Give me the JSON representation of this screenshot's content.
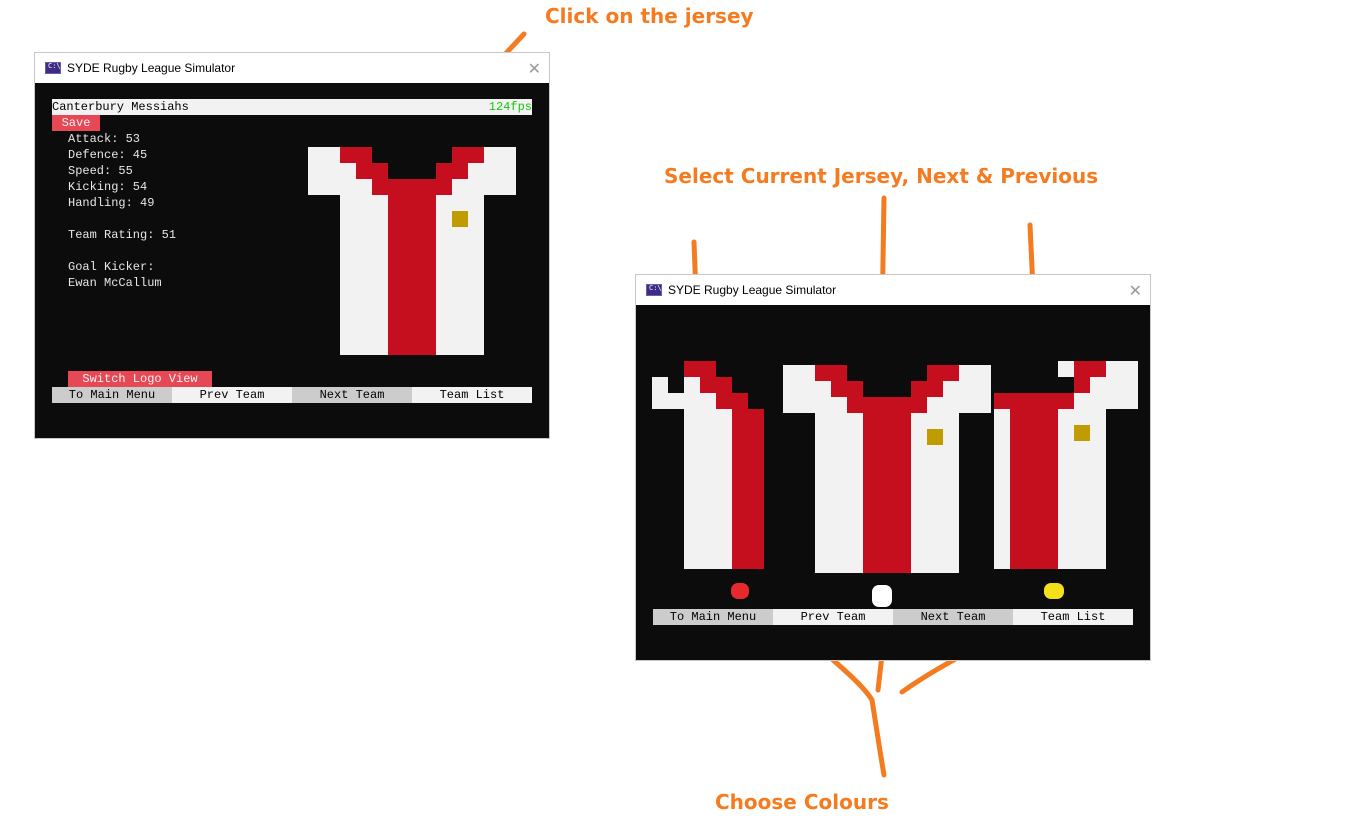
{
  "annotations": {
    "click_jersey": "Click on the jersey",
    "select_jersey": "Select Current Jersey, Next & Previous",
    "choose_colours": "Choose Colours"
  },
  "window": {
    "title": "SYDE Rugby League Simulator",
    "close_icon": "✕"
  },
  "team_view": {
    "team_name": "Canterbury Messiahs",
    "fps": "124fps",
    "save_label": "Save",
    "stats": {
      "attack": "Attack: 53",
      "defence": "Defence: 45",
      "speed": "Speed: 55",
      "kicking": "Kicking: 54",
      "handling": "Handling: 49",
      "team_rating": "Team Rating: 51",
      "goal_kicker_label": "Goal Kicker:",
      "goal_kicker_name": "Ewan McCallum"
    },
    "switch_logo_label": "Switch Logo View"
  },
  "nav": {
    "main_menu": "To Main Menu",
    "prev_team": "Prev Team",
    "next_team": "Next Team",
    "team_list": "Team List"
  },
  "colors": {
    "jersey_base": "#f2f2f2",
    "jersey_trim": "#c50f1f",
    "logo": "#c19c00",
    "console_bg": "#0c0c0c",
    "button_red": "#e74856",
    "fps_green": "#16c60c",
    "annotation": "#f47b20",
    "colour_dots": [
      "#e8292c",
      "#ffffff",
      "#f5e11b"
    ]
  }
}
